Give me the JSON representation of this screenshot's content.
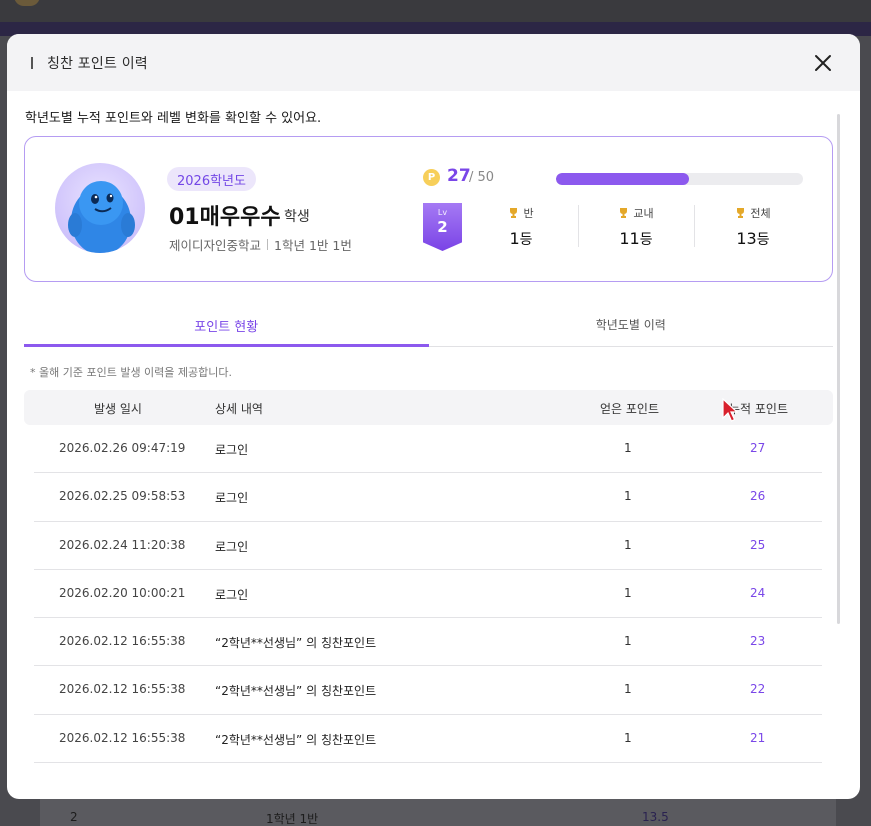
{
  "background": {
    "row_num": "2",
    "row_class": "1학년 1반",
    "row_value": "13.5"
  },
  "modal": {
    "title": "칭찬 포인트 이력",
    "description": "학년도별 누적 포인트와 레벨 변화를 확인할 수 있어요."
  },
  "profile": {
    "school_year": "2026학년도",
    "name": "01매우우수",
    "name_suffix": "학생",
    "school": "제이디자인중학교",
    "class": "1학년 1반 1번",
    "point_icon_letter": "P",
    "points_current": "27",
    "points_max": "/ 50",
    "progress_fraction": 0.54,
    "level_label": "Lv",
    "level": "2",
    "ranks": [
      {
        "label": "반",
        "value": "1",
        "unit": "등"
      },
      {
        "label": "교내",
        "value": "11",
        "unit": "등"
      },
      {
        "label": "전체",
        "value": "13",
        "unit": "등"
      }
    ]
  },
  "tabs": [
    {
      "label": "포인트 현황",
      "active": true
    },
    {
      "label": "학년도별 이력",
      "active": false
    }
  ],
  "notice": "* 올해 기준 포인트 발생 이력을 제공합니다.",
  "table": {
    "headers": [
      "발생 일시",
      "상세 내역",
      "얻은 포인트",
      "누적 포인트"
    ],
    "rows": [
      [
        "2026.02.26 09:47:19",
        "로그인",
        "1",
        "27"
      ],
      [
        "2026.02.25 09:58:53",
        "로그인",
        "1",
        "26"
      ],
      [
        "2026.02.24 11:20:38",
        "로그인",
        "1",
        "25"
      ],
      [
        "2026.02.20 10:00:21",
        "로그인",
        "1",
        "24"
      ],
      [
        "2026.02.12 16:55:38",
        "“2학년**선생님” 의 칭찬포인트",
        "1",
        "23"
      ],
      [
        "2026.02.12 16:55:38",
        "“2학년**선생님” 의 칭찬포인트",
        "1",
        "22"
      ],
      [
        "2026.02.12 16:55:38",
        "“2학년**선생님” 의 칭찬포인트",
        "1",
        "21"
      ]
    ]
  },
  "colors": {
    "accent": "#7a47e8",
    "card_border": "#b59cf2",
    "progress_fill": "#8c59ee"
  }
}
